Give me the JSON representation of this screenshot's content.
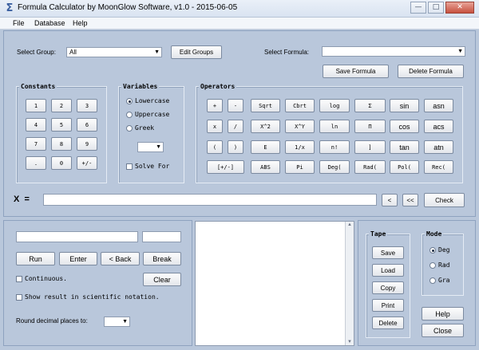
{
  "window": {
    "title": "Formula Calculator by MoonGlow Software, v1.0  -  2015-06-05",
    "app_icon": "Σ",
    "controls": {
      "minimize": "—",
      "maximize": "□",
      "close": "✕"
    }
  },
  "menu": [
    "File",
    "Database",
    "Help"
  ],
  "top": {
    "select_group_label": "Select Group:",
    "select_group_value": "All",
    "edit_groups": "Edit Groups",
    "select_formula_label": "Select Formula:",
    "select_formula_value": "",
    "save_formula": "Save Formula",
    "delete_formula": "Delete Formula"
  },
  "constants": {
    "title": "Constants",
    "keys": [
      "1",
      "2",
      "3",
      "4",
      "5",
      "6",
      "7",
      "8",
      "9",
      ".",
      "0",
      "+/-"
    ]
  },
  "variables": {
    "title": "Variables",
    "options": [
      "Lowercase",
      "Uppercase",
      "Greek"
    ],
    "selected": "Lowercase",
    "dropdown_value": "",
    "solve_for": "Solve For",
    "solve_for_checked": false
  },
  "operators": {
    "title": "Operators",
    "rows": [
      [
        "+",
        "-",
        "Sqrt",
        "Cbrt",
        "log",
        "Σ",
        "sin",
        "asn"
      ],
      [
        "x",
        "/",
        "X^2",
        "X^Y",
        "ln",
        "Π",
        "cos",
        "acs"
      ],
      [
        "(",
        ")",
        "E",
        "1/x",
        "n!",
        "]",
        "tan",
        "atn"
      ],
      [
        "[+/-]",
        "ABS",
        "Pi",
        "Deg(",
        "Rad(",
        "Pol(",
        "Rec("
      ]
    ]
  },
  "expression": {
    "label": "X  =",
    "value": "",
    "back_one": "<",
    "back_all": "<<",
    "check": "Check"
  },
  "run_panel": {
    "input1": "",
    "input2": "",
    "run": "Run",
    "enter": "Enter",
    "back": "< Back",
    "break": "Break",
    "continuous": "Continuous.",
    "continuous_checked": false,
    "clear": "Clear",
    "scientific": "Show result in scientific notation.",
    "scientific_checked": false,
    "round_label": "Round decimal places to:",
    "round_value": ""
  },
  "tape": {
    "title": "Tape",
    "buttons": [
      "Save",
      "Load",
      "Copy",
      "Print",
      "Delete"
    ]
  },
  "mode": {
    "title": "Mode",
    "options": [
      "Deg",
      "Rad",
      "Gra"
    ],
    "selected": "Deg"
  },
  "footer": {
    "help": "Help",
    "close": "Close"
  }
}
